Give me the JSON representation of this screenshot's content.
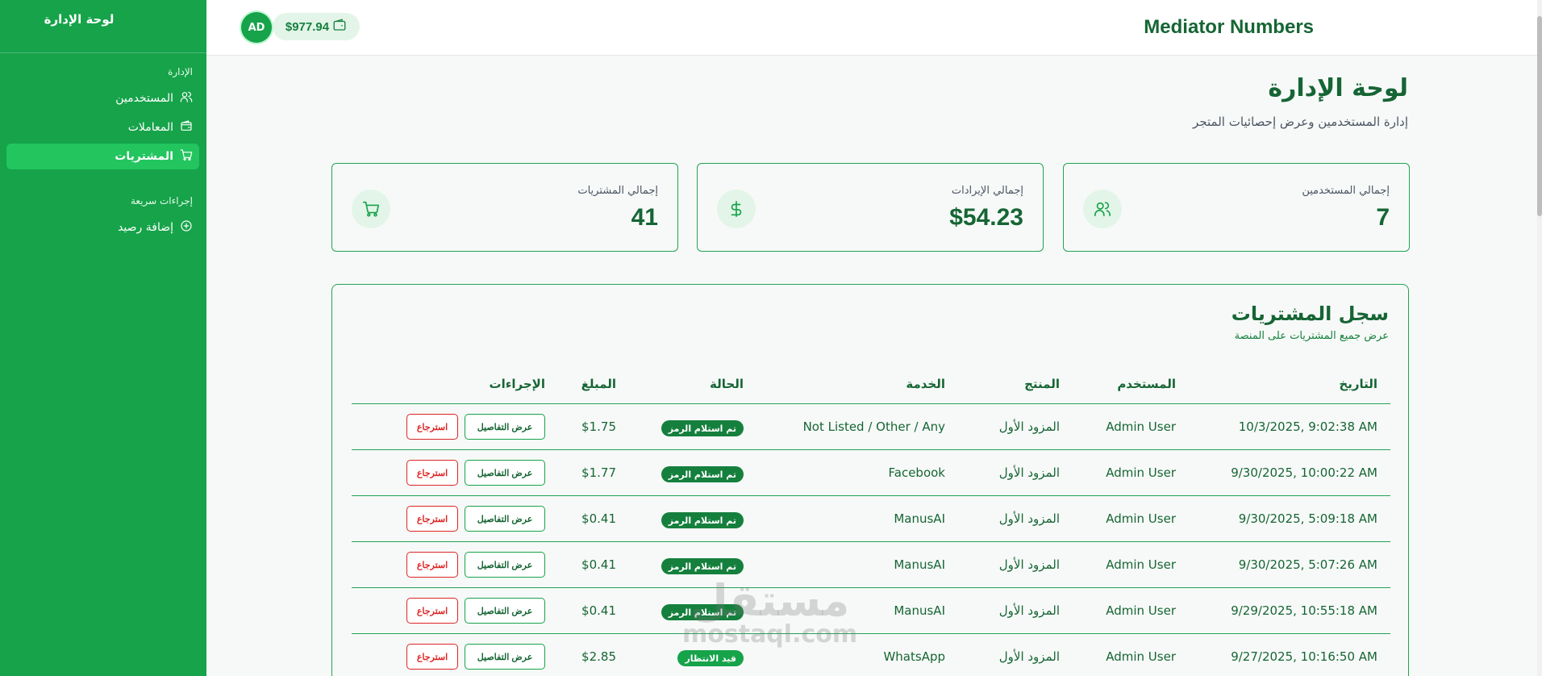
{
  "sidebar": {
    "title": "لوحة الإدارة",
    "section_admin": "الإدارة",
    "items": [
      {
        "label": "المستخدمين",
        "icon": "users-icon"
      },
      {
        "label": "المعاملات",
        "icon": "wallet-icon"
      },
      {
        "label": "المشتريات",
        "icon": "cart-icon",
        "active": true
      }
    ],
    "section_quick": "إجراءات سريعة",
    "quick_items": [
      {
        "label": "إضافة رصيد",
        "icon": "plus-circle-icon"
      }
    ]
  },
  "topbar": {
    "brand": "Mediator Numbers",
    "avatar_initials": "AD",
    "wallet_balance": "$977.94"
  },
  "page": {
    "title": "لوحة الإدارة",
    "subtitle": "إدارة المستخدمين وعرض إحصائيات المتجر"
  },
  "stats": [
    {
      "label": "إجمالي المستخدمين",
      "value": "7",
      "icon": "users-icon"
    },
    {
      "label": "إجمالي الإيرادات",
      "value": "$54.23",
      "icon": "dollar-icon"
    },
    {
      "label": "إجمالي المشتريات",
      "value": "41",
      "icon": "cart-icon"
    }
  ],
  "purchases": {
    "title": "سجل المشتريات",
    "subtitle": "عرض جميع المشتريات على المنصة",
    "columns": {
      "date": "التاريخ",
      "user": "المستخدم",
      "product": "المنتج",
      "service": "الخدمة",
      "status": "الحالة",
      "amount": "المبلغ",
      "actions": "الإجراءات"
    },
    "details_label": "عرض التفاصيل",
    "refund_label": "استرجاع",
    "rows": [
      {
        "date": "10/3/2025, 9:02:38 AM",
        "user": "Admin User",
        "product": "المزود الأول",
        "service": "Not Listed / Other / Any",
        "status": "تم استلام الرمز",
        "amount": "$1.75"
      },
      {
        "date": "9/30/2025, 10:00:22 AM",
        "user": "Admin User",
        "product": "المزود الأول",
        "service": "Facebook",
        "status": "تم استلام الرمز",
        "amount": "$1.77"
      },
      {
        "date": "9/30/2025, 5:09:18 AM",
        "user": "Admin User",
        "product": "المزود الأول",
        "service": "ManusAI",
        "status": "تم استلام الرمز",
        "amount": "$0.41"
      },
      {
        "date": "9/30/2025, 5:07:26 AM",
        "user": "Admin User",
        "product": "المزود الأول",
        "service": "ManusAI",
        "status": "تم استلام الرمز",
        "amount": "$0.41"
      },
      {
        "date": "9/29/2025, 10:55:18 AM",
        "user": "Admin User",
        "product": "المزود الأول",
        "service": "ManusAI",
        "status": "تم استلام الرمز",
        "amount": "$0.41"
      },
      {
        "date": "9/27/2025, 10:16:50 AM",
        "user": "Admin User",
        "product": "المزود الأول",
        "service": "WhatsApp",
        "status": "قيد الانتظار",
        "amount": "$2.85"
      }
    ]
  },
  "watermark": {
    "arabic": "مستقل",
    "latin": "mostaql.com"
  }
}
